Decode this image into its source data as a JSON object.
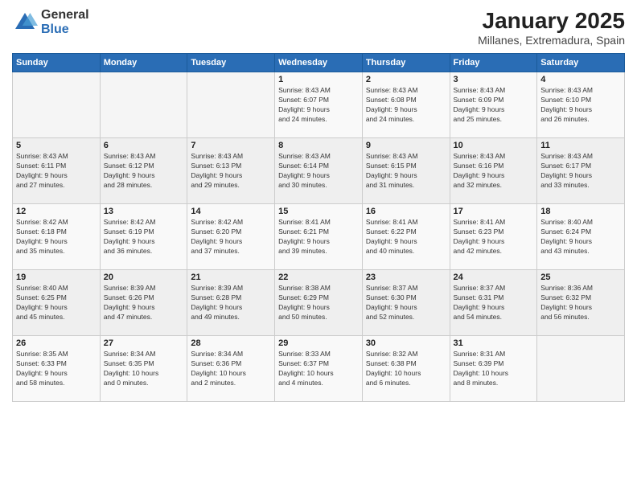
{
  "logo": {
    "general": "General",
    "blue": "Blue"
  },
  "title": "January 2025",
  "location": "Millanes, Extremadura, Spain",
  "weekdays": [
    "Sunday",
    "Monday",
    "Tuesday",
    "Wednesday",
    "Thursday",
    "Friday",
    "Saturday"
  ],
  "weeks": [
    [
      {
        "day": "",
        "info": ""
      },
      {
        "day": "",
        "info": ""
      },
      {
        "day": "",
        "info": ""
      },
      {
        "day": "1",
        "info": "Sunrise: 8:43 AM\nSunset: 6:07 PM\nDaylight: 9 hours\nand 24 minutes."
      },
      {
        "day": "2",
        "info": "Sunrise: 8:43 AM\nSunset: 6:08 PM\nDaylight: 9 hours\nand 24 minutes."
      },
      {
        "day": "3",
        "info": "Sunrise: 8:43 AM\nSunset: 6:09 PM\nDaylight: 9 hours\nand 25 minutes."
      },
      {
        "day": "4",
        "info": "Sunrise: 8:43 AM\nSunset: 6:10 PM\nDaylight: 9 hours\nand 26 minutes."
      }
    ],
    [
      {
        "day": "5",
        "info": "Sunrise: 8:43 AM\nSunset: 6:11 PM\nDaylight: 9 hours\nand 27 minutes."
      },
      {
        "day": "6",
        "info": "Sunrise: 8:43 AM\nSunset: 6:12 PM\nDaylight: 9 hours\nand 28 minutes."
      },
      {
        "day": "7",
        "info": "Sunrise: 8:43 AM\nSunset: 6:13 PM\nDaylight: 9 hours\nand 29 minutes."
      },
      {
        "day": "8",
        "info": "Sunrise: 8:43 AM\nSunset: 6:14 PM\nDaylight: 9 hours\nand 30 minutes."
      },
      {
        "day": "9",
        "info": "Sunrise: 8:43 AM\nSunset: 6:15 PM\nDaylight: 9 hours\nand 31 minutes."
      },
      {
        "day": "10",
        "info": "Sunrise: 8:43 AM\nSunset: 6:16 PM\nDaylight: 9 hours\nand 32 minutes."
      },
      {
        "day": "11",
        "info": "Sunrise: 8:43 AM\nSunset: 6:17 PM\nDaylight: 9 hours\nand 33 minutes."
      }
    ],
    [
      {
        "day": "12",
        "info": "Sunrise: 8:42 AM\nSunset: 6:18 PM\nDaylight: 9 hours\nand 35 minutes."
      },
      {
        "day": "13",
        "info": "Sunrise: 8:42 AM\nSunset: 6:19 PM\nDaylight: 9 hours\nand 36 minutes."
      },
      {
        "day": "14",
        "info": "Sunrise: 8:42 AM\nSunset: 6:20 PM\nDaylight: 9 hours\nand 37 minutes."
      },
      {
        "day": "15",
        "info": "Sunrise: 8:41 AM\nSunset: 6:21 PM\nDaylight: 9 hours\nand 39 minutes."
      },
      {
        "day": "16",
        "info": "Sunrise: 8:41 AM\nSunset: 6:22 PM\nDaylight: 9 hours\nand 40 minutes."
      },
      {
        "day": "17",
        "info": "Sunrise: 8:41 AM\nSunset: 6:23 PM\nDaylight: 9 hours\nand 42 minutes."
      },
      {
        "day": "18",
        "info": "Sunrise: 8:40 AM\nSunset: 6:24 PM\nDaylight: 9 hours\nand 43 minutes."
      }
    ],
    [
      {
        "day": "19",
        "info": "Sunrise: 8:40 AM\nSunset: 6:25 PM\nDaylight: 9 hours\nand 45 minutes."
      },
      {
        "day": "20",
        "info": "Sunrise: 8:39 AM\nSunset: 6:26 PM\nDaylight: 9 hours\nand 47 minutes."
      },
      {
        "day": "21",
        "info": "Sunrise: 8:39 AM\nSunset: 6:28 PM\nDaylight: 9 hours\nand 49 minutes."
      },
      {
        "day": "22",
        "info": "Sunrise: 8:38 AM\nSunset: 6:29 PM\nDaylight: 9 hours\nand 50 minutes."
      },
      {
        "day": "23",
        "info": "Sunrise: 8:37 AM\nSunset: 6:30 PM\nDaylight: 9 hours\nand 52 minutes."
      },
      {
        "day": "24",
        "info": "Sunrise: 8:37 AM\nSunset: 6:31 PM\nDaylight: 9 hours\nand 54 minutes."
      },
      {
        "day": "25",
        "info": "Sunrise: 8:36 AM\nSunset: 6:32 PM\nDaylight: 9 hours\nand 56 minutes."
      }
    ],
    [
      {
        "day": "26",
        "info": "Sunrise: 8:35 AM\nSunset: 6:33 PM\nDaylight: 9 hours\nand 58 minutes."
      },
      {
        "day": "27",
        "info": "Sunrise: 8:34 AM\nSunset: 6:35 PM\nDaylight: 10 hours\nand 0 minutes."
      },
      {
        "day": "28",
        "info": "Sunrise: 8:34 AM\nSunset: 6:36 PM\nDaylight: 10 hours\nand 2 minutes."
      },
      {
        "day": "29",
        "info": "Sunrise: 8:33 AM\nSunset: 6:37 PM\nDaylight: 10 hours\nand 4 minutes."
      },
      {
        "day": "30",
        "info": "Sunrise: 8:32 AM\nSunset: 6:38 PM\nDaylight: 10 hours\nand 6 minutes."
      },
      {
        "day": "31",
        "info": "Sunrise: 8:31 AM\nSunset: 6:39 PM\nDaylight: 10 hours\nand 8 minutes."
      },
      {
        "day": "",
        "info": ""
      }
    ]
  ]
}
